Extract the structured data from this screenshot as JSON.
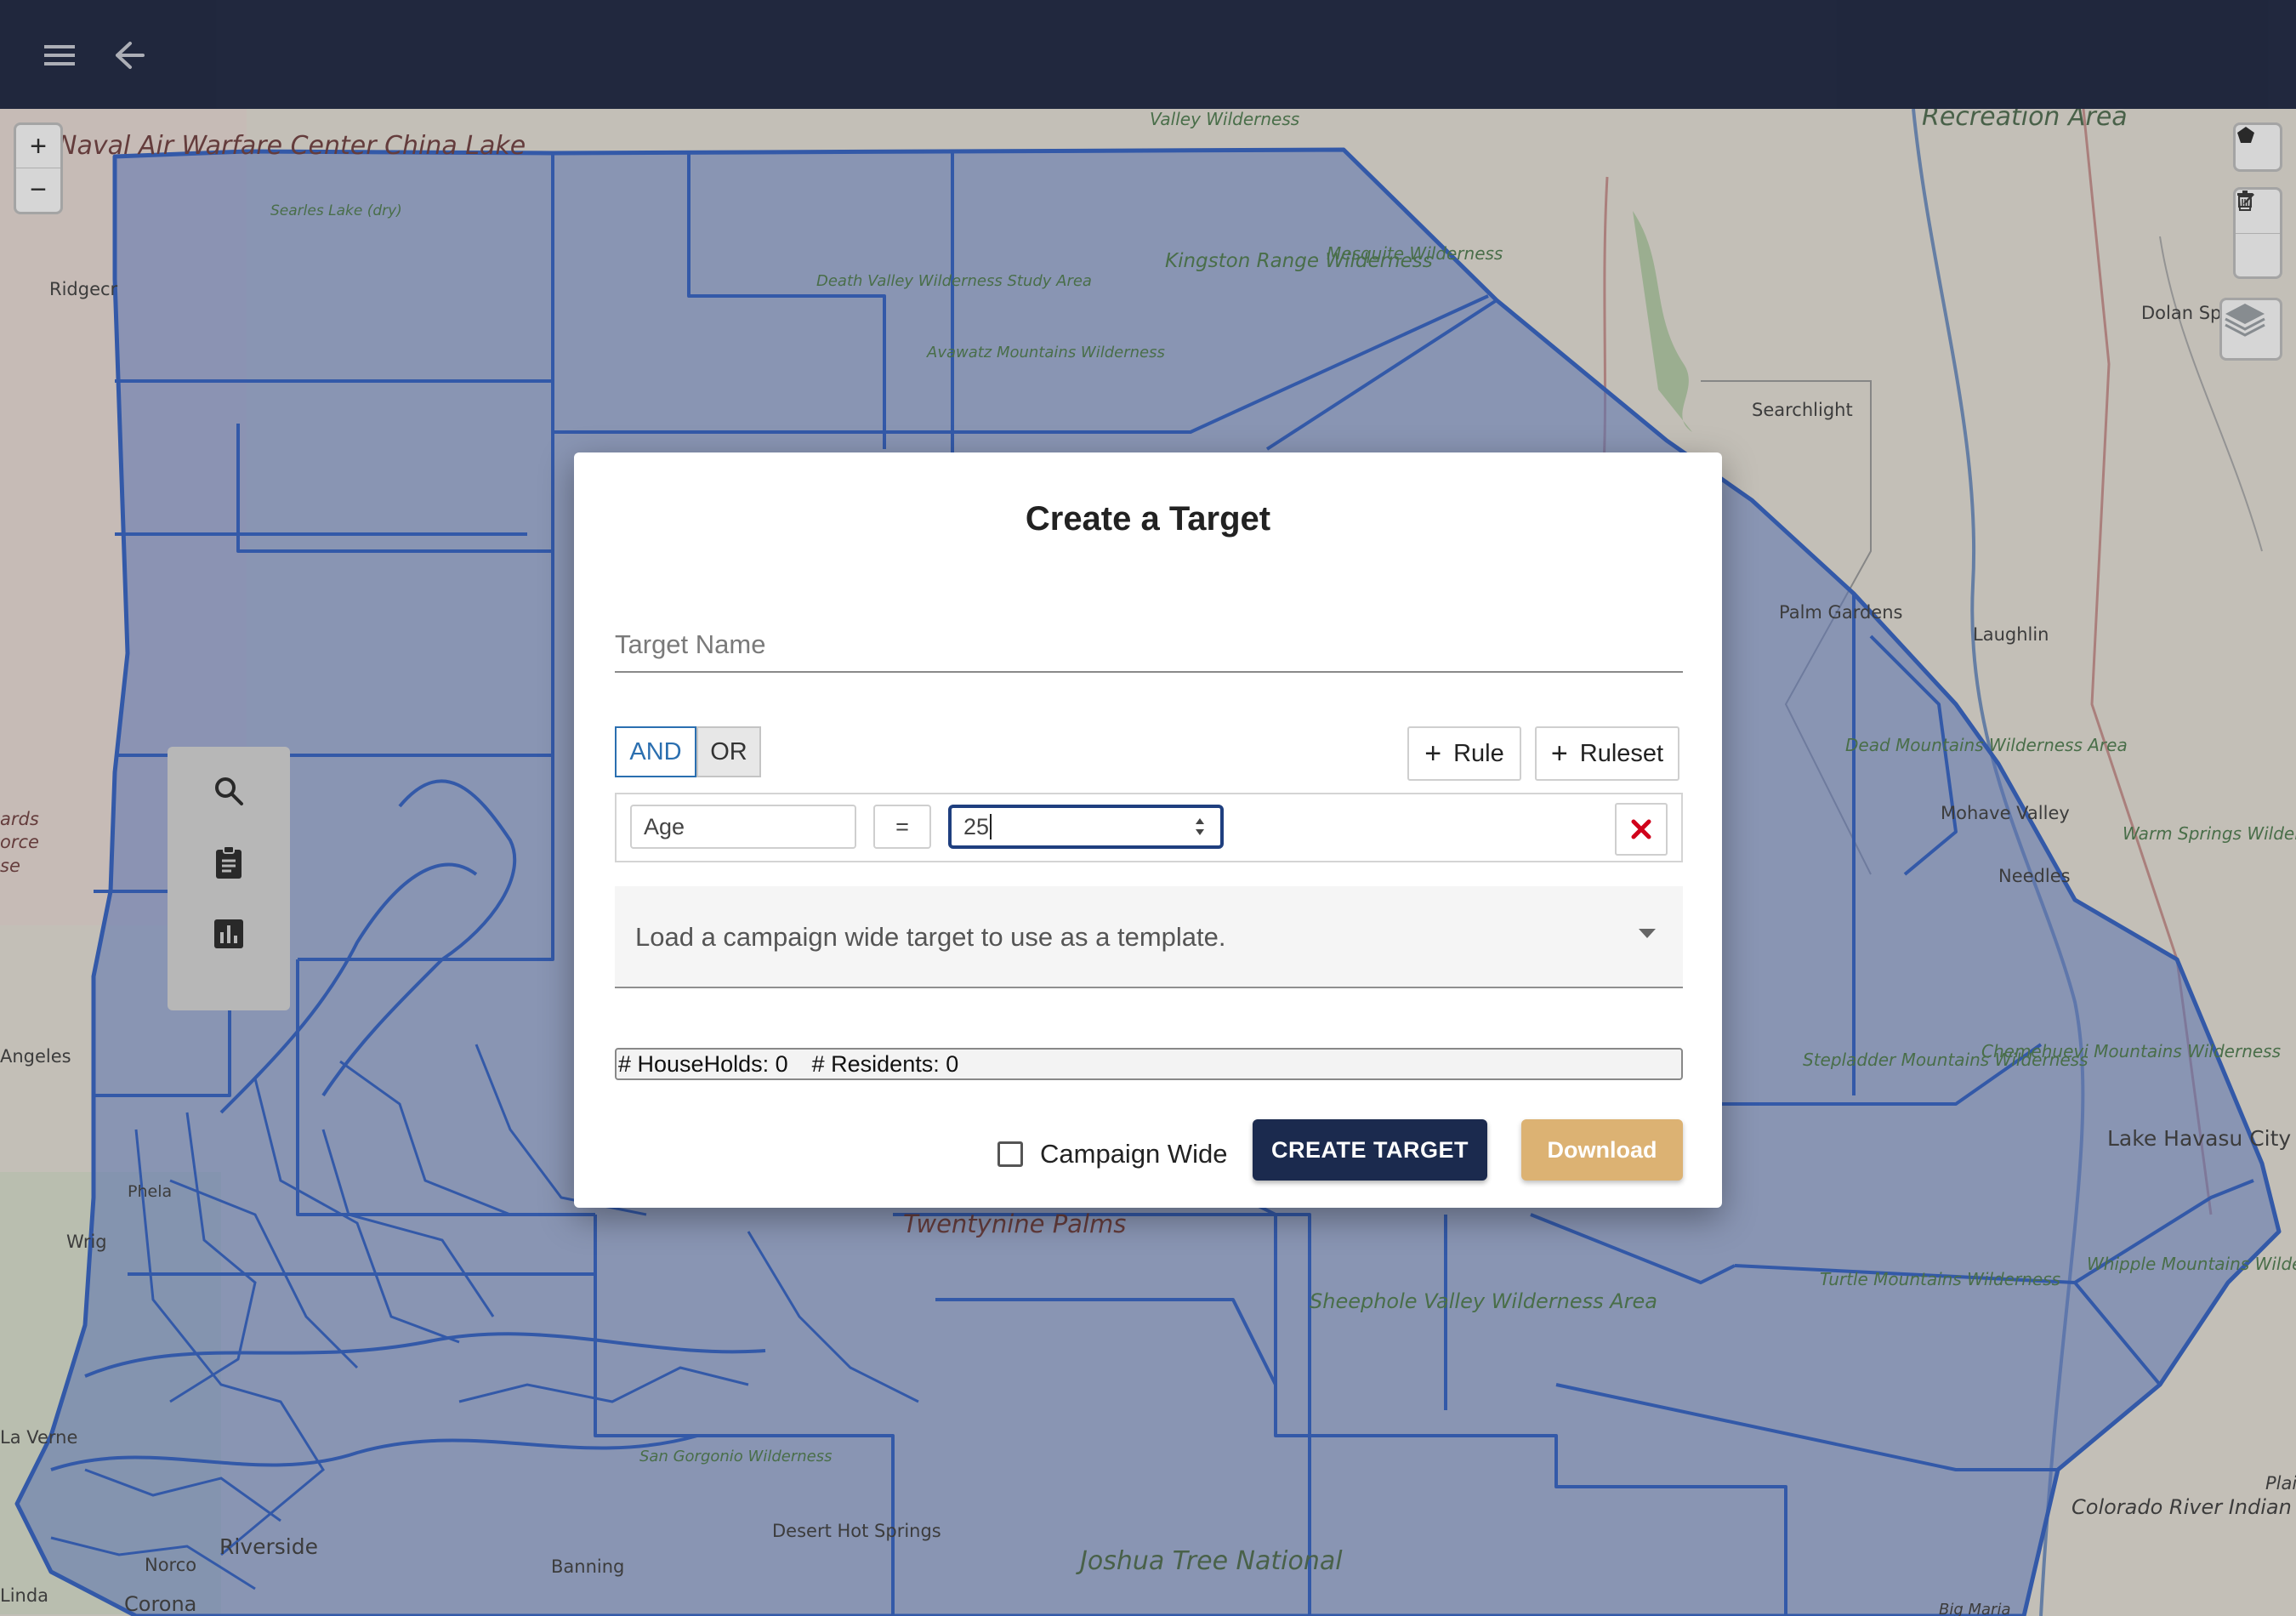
{
  "header": {
    "menu_icon": "menu-icon",
    "back_icon": "arrow-left-icon"
  },
  "map": {
    "zoom_in": "+",
    "zoom_out": "−",
    "labels": {
      "naval": "Naval Air Warfare Center China Lake",
      "searles": "Searles Lake (dry)",
      "ridgecrest": "Ridgecr",
      "valley_wild": "Valley Wilderness",
      "death_valley": "Death Valley Wilderness Study Area",
      "avawatz": "Avawatz Mountains Wilderness",
      "kingston": "Kingston Range Wilderness",
      "mesquite": "Mesquite Wilderness",
      "recreation": "Recreation Area",
      "dolan": "Dolan Spr",
      "searchlight": "Searchlight",
      "palm_gardens": "Palm Gardens",
      "laughlin": "Laughlin",
      "dead_mountains": "Dead Mountains Wilderness Area",
      "mohave_valley": "Mohave Valley",
      "warm_springs": "Warm Springs Wilderness",
      "needles": "Needles",
      "stepladder": "Stepladder Mountains Wilderness",
      "chemehuevi": "Chemehuevi Mountains Wilderness",
      "lake_havasu": "Lake Havasu City",
      "twentynine": "Twentynine Palms",
      "sheephole": "Sheephole Valley Wilderness Area",
      "turtle": "Turtle Mountains Wilderness",
      "whipple": "Whipple Mountains Wilderness",
      "colorado": "Colorado River Indian Tribes",
      "joshua": "Joshua Tree National",
      "riverside": "Riverside",
      "norco": "Norco",
      "corona": "Corona",
      "banning": "Banning",
      "desert_hot": "Desert Hot Springs",
      "san_gorgonio": "San Gorgonio Wilderness",
      "angeles": "Angeles",
      "la_verne": "La Verne",
      "linda": "Linda",
      "big_maria": "Big Maria",
      "plain": "Plain",
      "ards": "ards orce se",
      "wrig": "Wrig",
      "phela": "Phela"
    }
  },
  "tool_panel": {
    "icons": [
      "search-icon",
      "clipboard-icon",
      "bar-chart-icon"
    ]
  },
  "dialog": {
    "title": "Create a Target",
    "target_name_placeholder": "Target Name",
    "combinator": {
      "and": "AND",
      "or": "OR",
      "selected": "AND"
    },
    "add_rule": "Rule",
    "add_ruleset": "Ruleset",
    "rule": {
      "field": "Age",
      "operator": "=",
      "value": "25"
    },
    "template_select": "Load a campaign wide target to use as a template.",
    "households": "# HouseHolds: 0",
    "residents": "# Residents: 0",
    "campaign_wide": "Campaign Wide",
    "campaign_wide_checked": false,
    "create_button": "CREATE TARGET",
    "download_button": "Download"
  },
  "colors": {
    "header_bg": "#161f3c",
    "region_fill": "#5b7fd0",
    "region_stroke": "#2f5fc4",
    "primary_button": "#1b2a4e",
    "download_button": "#dcb273",
    "delete_icon": "#d0021b"
  }
}
